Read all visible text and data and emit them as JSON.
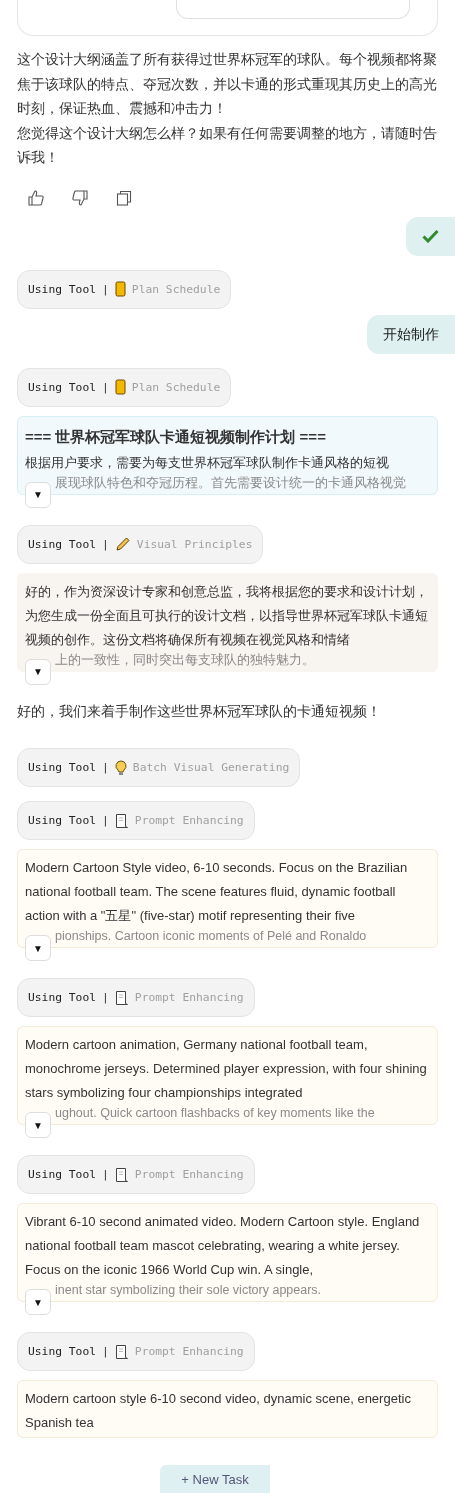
{
  "messages": [
    {
      "kind": "top_card"
    },
    {
      "kind": "text",
      "paragraphs": [
        "这个设计大纲涵盖了所有获得过世界杯冠军的球队。每个视频都将聚焦于该球队的特点、夺冠次数，并以卡通的形式重现其历史上的高光时刻，保证热血、震撼和冲击力！",
        "您觉得这个设计大纲怎么样？如果有任何需要调整的地方，请随时告诉我！"
      ]
    },
    {
      "kind": "feedback"
    },
    {
      "kind": "user_check"
    },
    {
      "kind": "schedule_tool",
      "label": "Using Tool",
      "separator": "|",
      "name": "Plan Schedule"
    },
    {
      "kind": "user",
      "text": "开始制作"
    },
    {
      "kind": "schedule_tool",
      "label": "Using Tool",
      "separator": "|",
      "name": "Plan Schedule"
    },
    {
      "kind": "plan_card",
      "title": "=== 世界杯冠军球队卡通短视频制作计划 ===",
      "text": "根据用户要求，需要为每支世界杯冠军球队制作卡通风格的短视",
      "faded": "展现球队特色和夺冠历程。首先需要设计统一的卡通风格视觉",
      "toggle": "▼"
    },
    {
      "kind": "pencil_tool",
      "label": "Using Tool",
      "separator": "|",
      "name": "Visual Principles"
    },
    {
      "kind": "note_card",
      "text": "好的，作为资深设计专家和创意总监，我将根据您的要求和设计计划，为您生成一份全面且可执行的设计文档，以指导世界杯冠军球队卡通短视频的创作。这份文档将确保所有视频在视觉风格和情绪",
      "faded": "上的一致性，同时突出每支球队的独特魅力。",
      "toggle": "▼"
    },
    {
      "kind": "text",
      "paragraphs": [
        "好的，我们来着手制作这些世界杯冠军球队的卡通短视频！"
      ]
    },
    {
      "kind": "bulb_tool",
      "label": "Using Tool",
      "separator": "|",
      "name": "Batch Visual Generating"
    },
    {
      "kind": "document_tool",
      "label": "Using Tool",
      "separator": "|",
      "name": "Prompt Enhancing"
    },
    {
      "kind": "prompt_card",
      "text": "Modern Cartoon Style video, 6-10 seconds. Focus on the Brazilian national football team. The scene features fluid, dynamic football action with a \"五星\" (five-star) motif representing their five",
      "faded": "pionships. Cartoon iconic moments of Pelé and Ronaldo",
      "toggle": "▼"
    },
    {
      "kind": "document_tool",
      "label": "Using Tool",
      "separator": "|",
      "name": "Prompt Enhancing"
    },
    {
      "kind": "prompt_card",
      "text": "Modern cartoon animation, Germany national football team, monochrome jerseys. Determined player expression, with four shining stars symbolizing four championships integrated",
      "faded": "ughout. Quick cartoon flashbacks of key moments like the",
      "toggle": "▼"
    },
    {
      "kind": "document_tool",
      "label": "Using Tool",
      "separator": "|",
      "name": "Prompt Enhancing"
    },
    {
      "kind": "prompt_card",
      "text": "Vibrant 6-10 second animated video. Modern Cartoon style. England national football team mascot celebrating, wearing a white jersey. Focus on the iconic 1966 World Cup win. A single,",
      "faded": "inent star symbolizing their sole victory appears.",
      "toggle": "▼"
    },
    {
      "kind": "document_tool",
      "label": "Using Tool",
      "separator": "|",
      "name": "Prompt Enhancing"
    },
    {
      "kind": "prompt_card",
      "text": "Modern cartoon style 6-10 second video, dynamic scene, energetic Spanish tea"
    }
  ],
  "new_task": "+ New Task"
}
